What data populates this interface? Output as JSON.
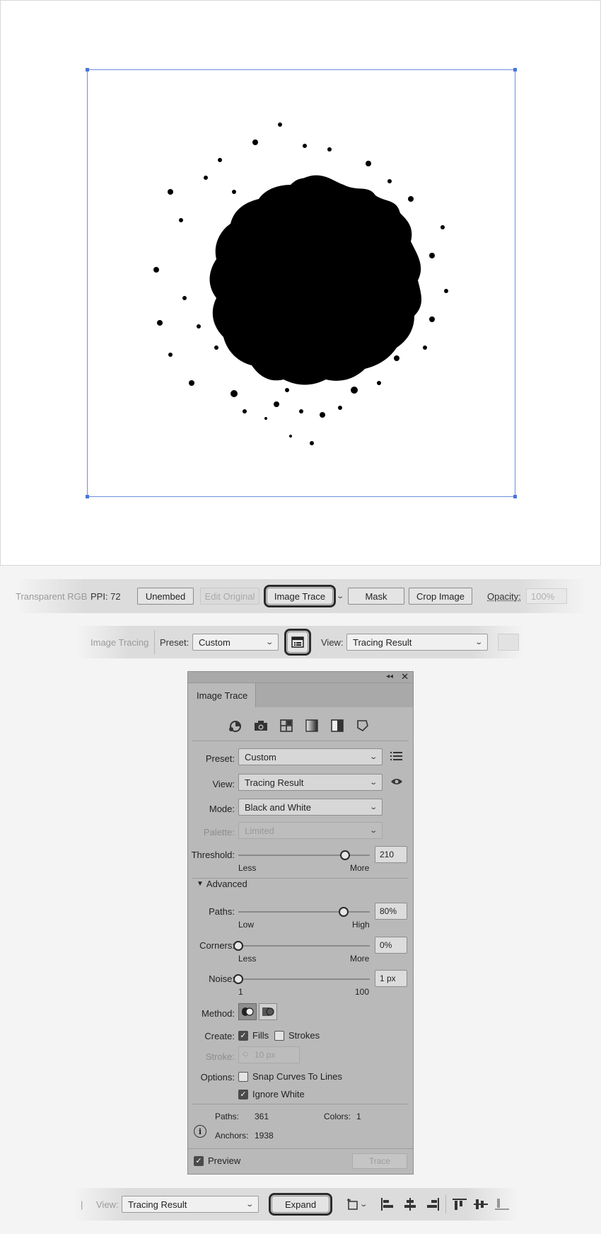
{
  "control_bar_1": {
    "color_mode": "Transparent RGB",
    "ppi": "PPI: 72",
    "unembed": "Unembed",
    "edit_original": "Edit Original",
    "image_trace": "Image Trace",
    "mask": "Mask",
    "crop_image": "Crop Image",
    "opacity_label": "Opacity:",
    "opacity_value": "100%"
  },
  "control_bar_2": {
    "mode_label": "Image Tracing",
    "preset_label": "Preset:",
    "preset_value": "Custom",
    "view_label": "View:",
    "view_value": "Tracing Result"
  },
  "panel": {
    "title": "Image Trace",
    "preset_label": "Preset:",
    "preset_value": "Custom",
    "view_label": "View:",
    "view_value": "Tracing Result",
    "mode_label": "Mode:",
    "mode_value": "Black and White",
    "palette_label": "Palette:",
    "palette_value": "Limited",
    "threshold_label": "Threshold:",
    "threshold_value": "210",
    "threshold_level": 0.81,
    "threshold_less": "Less",
    "threshold_more": "More",
    "advanced_label": "Advanced",
    "paths_label": "Paths:",
    "paths_value": "80%",
    "paths_level": 0.8,
    "paths_low": "Low",
    "paths_high": "High",
    "corners_label": "Corners:",
    "corners_value": "0%",
    "corners_level": 0,
    "corners_less": "Less",
    "corners_more": "More",
    "noise_label": "Noise:",
    "noise_value": "1 px",
    "noise_level": 0,
    "noise_min": "1",
    "noise_max": "100",
    "method_label": "Method:",
    "create_label": "Create:",
    "fills_label": "Fills",
    "strokes_label": "Strokes",
    "stroke_label": "Stroke:",
    "stroke_value": "10 px",
    "options_label": "Options:",
    "snap_label": "Snap Curves To Lines",
    "ignore_white_label": "Ignore White",
    "info_paths_label": "Paths:",
    "info_paths_value": "361",
    "info_colors_label": "Colors:",
    "info_colors_value": "1",
    "info_anchors_label": "Anchors:",
    "info_anchors_value": "1938",
    "preview_label": "Preview",
    "trace_label": "Trace"
  },
  "control_bar_3": {
    "view_label": "View:",
    "view_value": "Tracing Result",
    "expand": "Expand"
  },
  "colors": {
    "selection": "#6b8fe0",
    "highlight": "#2b2b2b"
  }
}
